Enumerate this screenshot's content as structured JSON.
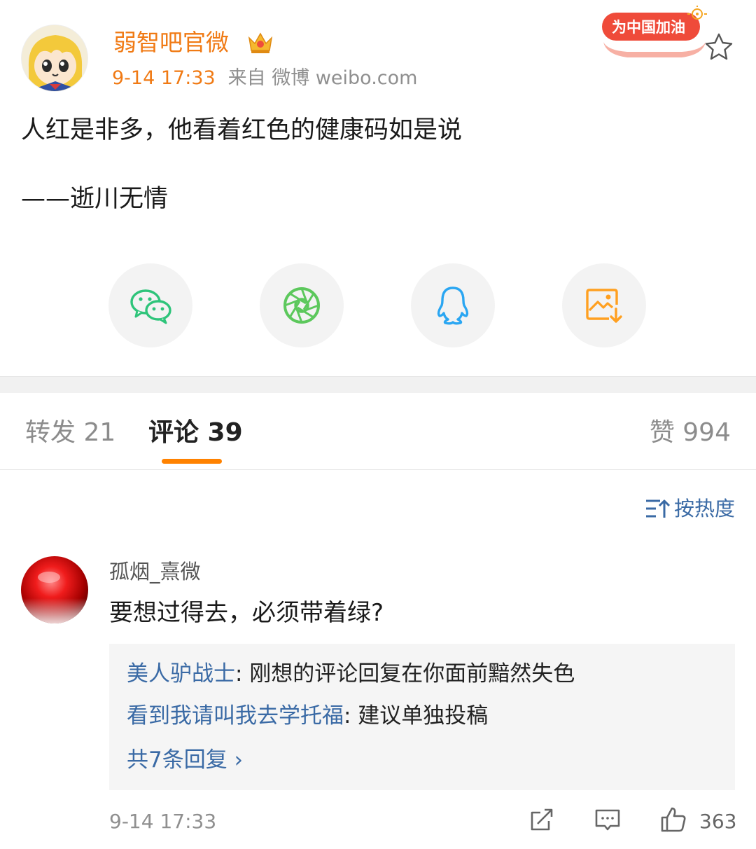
{
  "post": {
    "author": "弱智吧官微",
    "time": "9-14 17:33",
    "source": "来自 微博 weibo.com",
    "badge": "为中国加油",
    "text": "人红是非多，他看着红色的健康码如是说",
    "signature": "——逝川无情",
    "icons": {
      "crown": "crown-icon",
      "star": "star-icon",
      "avatar": "anime-girl-avatar"
    }
  },
  "share": [
    {
      "name": "wechat",
      "icon": "wechat-icon",
      "color": "#2ec47a"
    },
    {
      "name": "moments",
      "icon": "aperture-icon",
      "color": "#5cc85c"
    },
    {
      "name": "qq",
      "icon": "qq-penguin-icon",
      "color": "#2aa6f2"
    },
    {
      "name": "save-image",
      "icon": "image-download-icon",
      "color": "#ffa020"
    }
  ],
  "tabs": {
    "repost": "转发 21",
    "comments": "评论 39",
    "likes": "赞 994"
  },
  "sort": {
    "label": "按热度",
    "icon": "sort-icon"
  },
  "comment": {
    "user": "孤烟_熹微",
    "text": "要想过得去，必须带着绿?",
    "time": "9-14 17:33",
    "like_count": "363",
    "replies": [
      {
        "user": "美人驴战士",
        "text": ": 刚想的评论回复在你面前黯然失色"
      },
      {
        "user": "看到我请叫我去学托福",
        "text": ": 建议单独投稿"
      }
    ],
    "more": "共7条回复 ›"
  },
  "colors": {
    "accent": "#ff8200",
    "author": "#f07a14",
    "link": "#3a6aa5"
  }
}
